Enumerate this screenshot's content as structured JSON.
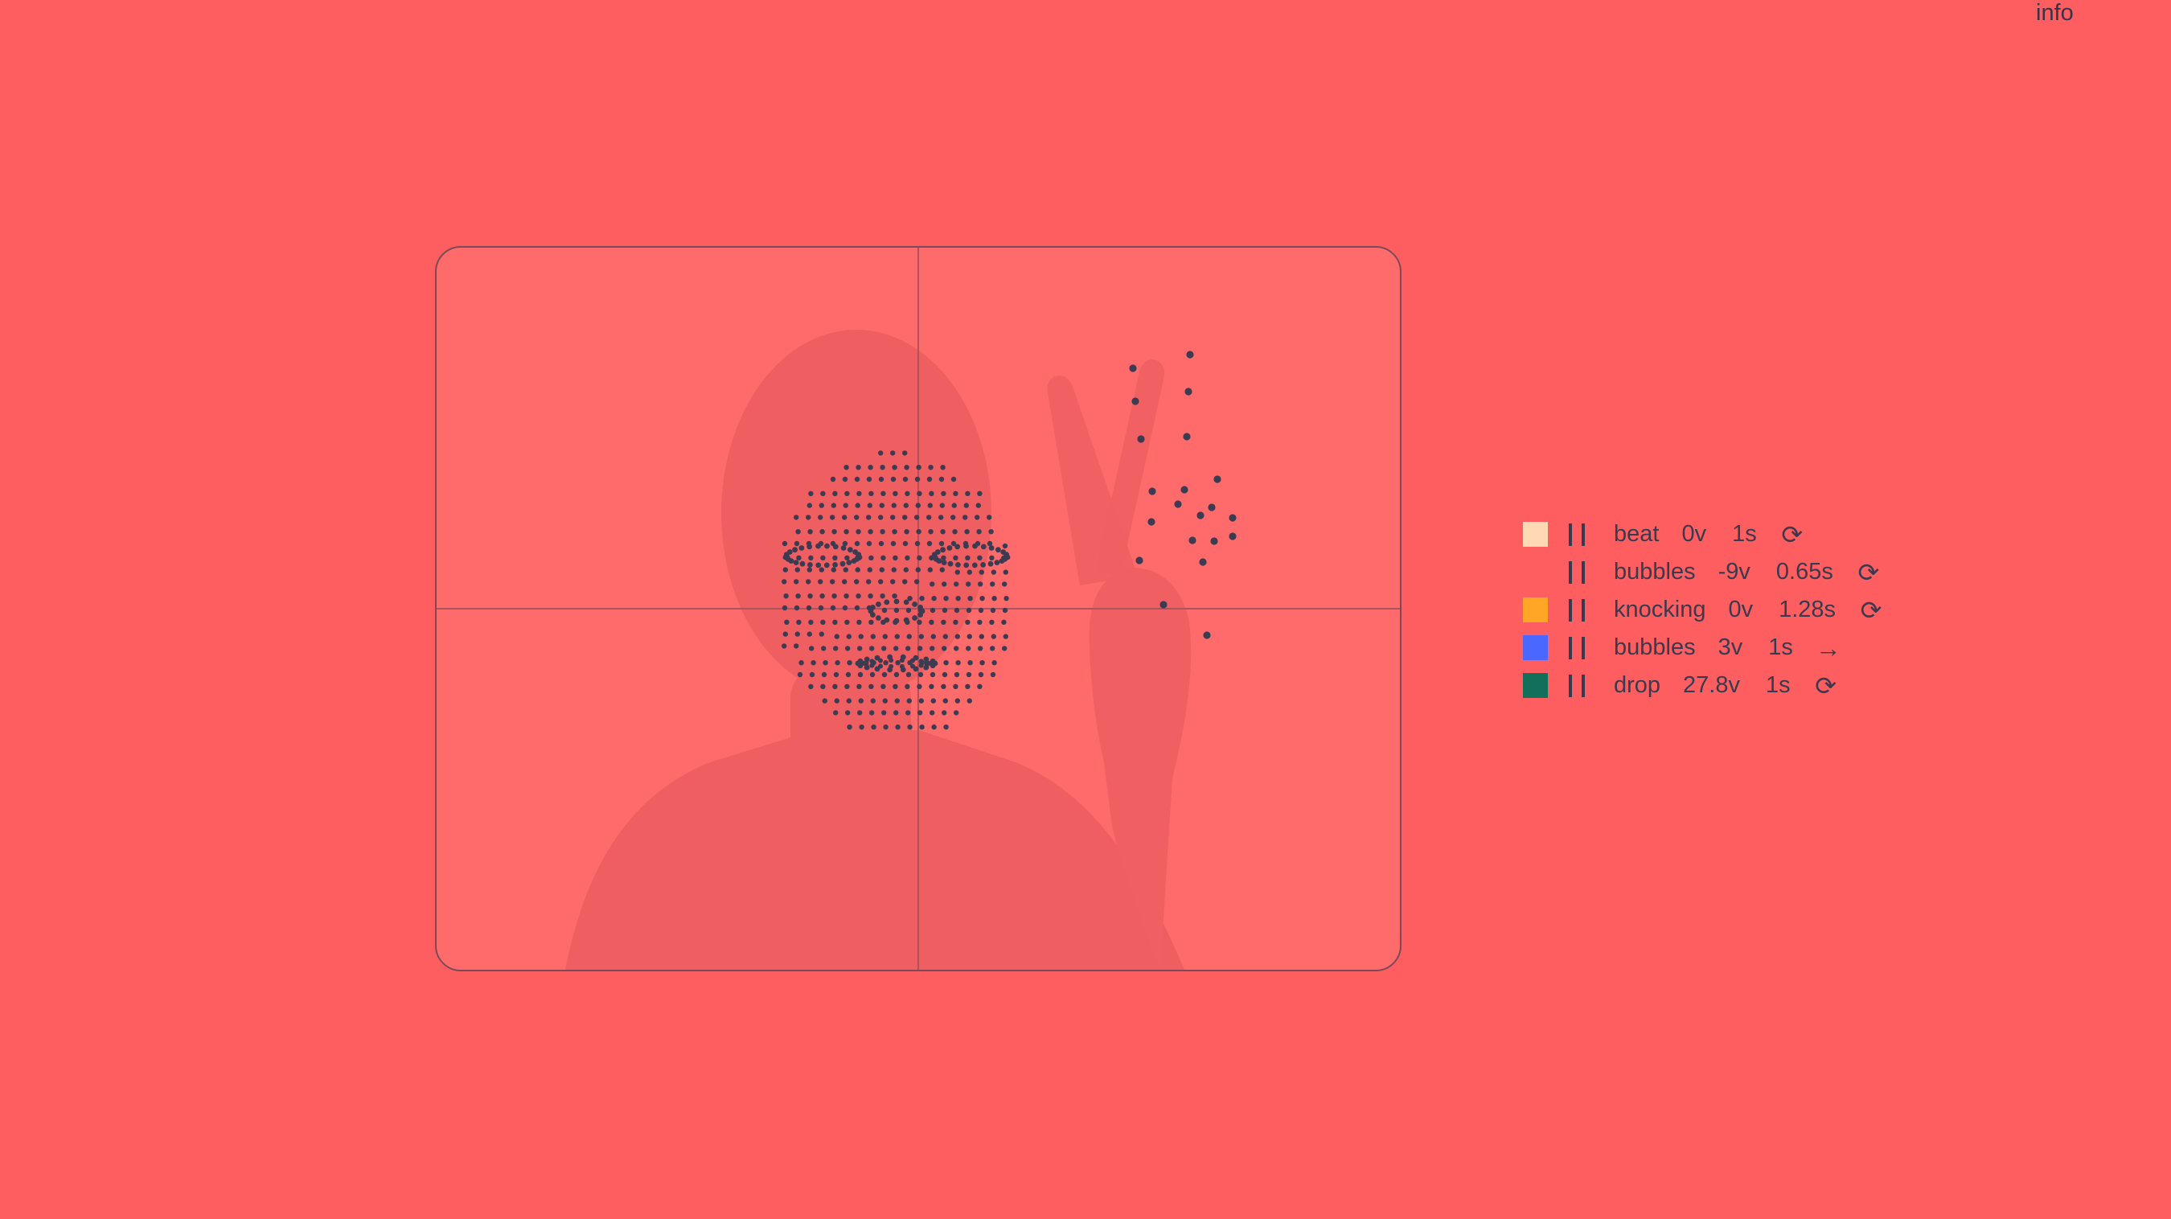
{
  "header": {
    "info_label": "info"
  },
  "tracker": {
    "icon": "face-and-hand-landmark-tracking",
    "background_color": "#ff6b6b",
    "point_color": "#3b3b52"
  },
  "sounds": [
    {
      "name": "beat",
      "volume": "0v",
      "duration": "1s",
      "color": "#ffd8b5",
      "mode_icon": "loop-icon",
      "mode_glyph": "⟳",
      "pause_icon": "pause-icon"
    },
    {
      "name": "bubbles",
      "volume": "-9v",
      "duration": "0.65s",
      "color": "#ff5e60",
      "mode_icon": "loop-icon",
      "mode_glyph": "⟳",
      "pause_icon": "pause-icon"
    },
    {
      "name": "knocking",
      "volume": "0v",
      "duration": "1.28s",
      "color": "#ffa626",
      "mode_icon": "loop-icon",
      "mode_glyph": "⟳",
      "pause_icon": "pause-icon"
    },
    {
      "name": "bubbles",
      "volume": "3v",
      "duration": "1s",
      "color": "#4a68ff",
      "mode_icon": "arrow-right-icon",
      "mode_glyph": "→",
      "pause_icon": "pause-icon"
    },
    {
      "name": "drop",
      "volume": "27.8v",
      "duration": "1s",
      "color": "#12705a",
      "mode_icon": "loop-icon",
      "mode_glyph": "⟳",
      "pause_icon": "pause-icon"
    }
  ]
}
